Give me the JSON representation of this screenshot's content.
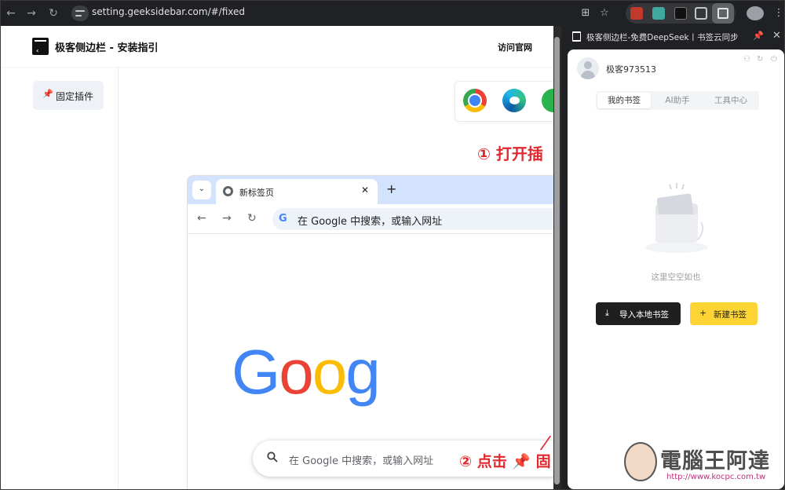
{
  "browser": {
    "url": "setting.geeksidebar.com/#/fixed"
  },
  "site": {
    "title": "极客侧边栏 - 安装指引",
    "visit_link": "访问官网",
    "pin_button": "固定插件",
    "step1_text": "① 打开插",
    "step2_text": "② 点击 📌 固"
  },
  "mock_browser": {
    "tab_title": "新标签页",
    "omnibox_text": "在 Google 中搜索，或输入网址",
    "search_placeholder": "在 Google 中搜索，或输入网址",
    "logo_letters": [
      "G",
      "o",
      "o",
      "g"
    ],
    "logo_colors": [
      "#4285f4",
      "#ea4335",
      "#fbbc05",
      "#4285f4"
    ]
  },
  "side_panel": {
    "title": "极客侧边栏-免费DeepSeek丨书签云同步",
    "username": "极客973513",
    "tabs": [
      {
        "label": "我的书签",
        "active": true
      },
      {
        "label": "AI助手",
        "active": false
      },
      {
        "label": "工具中心",
        "active": false
      }
    ],
    "empty_text": "这里空空如也",
    "import_button": "导入本地书签",
    "new_button": "新建书签"
  },
  "watermark": {
    "text": "電腦王阿達",
    "url": "http://www.kocpc.com.tw"
  },
  "colors": {
    "accent_red": "#e0282e",
    "accent_yellow": "#fcd535",
    "dark_button": "#1f1f1f"
  }
}
